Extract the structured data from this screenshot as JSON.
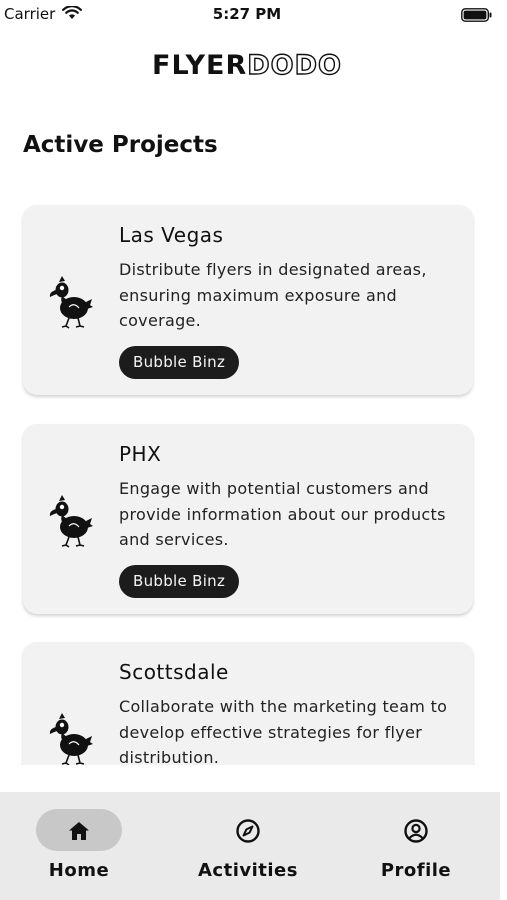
{
  "status_bar": {
    "carrier": "Carrier",
    "time": "5:27 PM"
  },
  "logo": {
    "part1": "FLYER",
    "part2": "DODO"
  },
  "section_title": "Active Projects",
  "projects": [
    {
      "title": "Las Vegas",
      "description": "Distribute flyers in designated areas, ensuring maximum exposure and coverage.",
      "client": "Bubble Binz",
      "icon": "dodo-bird-icon"
    },
    {
      "title": "PHX",
      "description": "Engage with potential customers and provide information about our products and services.",
      "client": "Bubble Binz",
      "icon": "dodo-bird-icon"
    },
    {
      "title": "Scottsdale",
      "description": "Collaborate with the marketing team to develop effective strategies for flyer distribution.",
      "client": "",
      "icon": "dodo-bird-icon"
    }
  ],
  "tabs": [
    {
      "label": "Home",
      "icon": "home-icon",
      "active": true
    },
    {
      "label": "Activities",
      "icon": "compass-icon",
      "active": false
    },
    {
      "label": "Profile",
      "icon": "profile-icon",
      "active": false
    }
  ],
  "colors": {
    "card_bg": "#f2f2f2",
    "chip_bg": "#1c1c1c",
    "tabbar_bg": "#eaeaea",
    "active_pill": "#c8c8c8"
  }
}
